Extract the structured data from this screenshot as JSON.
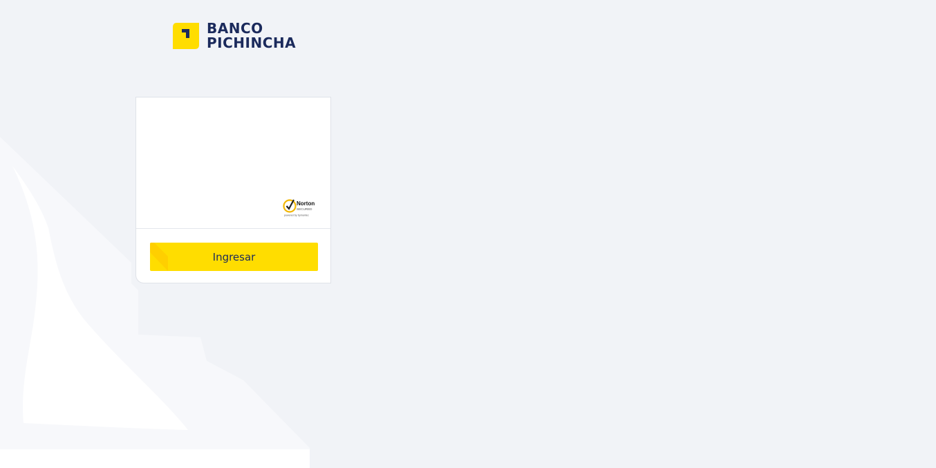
{
  "brand": {
    "name_line1": "BANCO",
    "name_line2": "PICHINCHA",
    "logo_color": "#ffdd00",
    "text_color": "#1b2a5c"
  },
  "security_badge": {
    "icon": "norton-secured-icon",
    "title": "Norton",
    "subtitle": "SECURED",
    "powered_by": "powered by Symantec"
  },
  "login": {
    "button_label": "Ingresar",
    "button_color": "#ffdd00"
  },
  "colors": {
    "background": "#f1f3f7",
    "card": "#ffffff"
  }
}
